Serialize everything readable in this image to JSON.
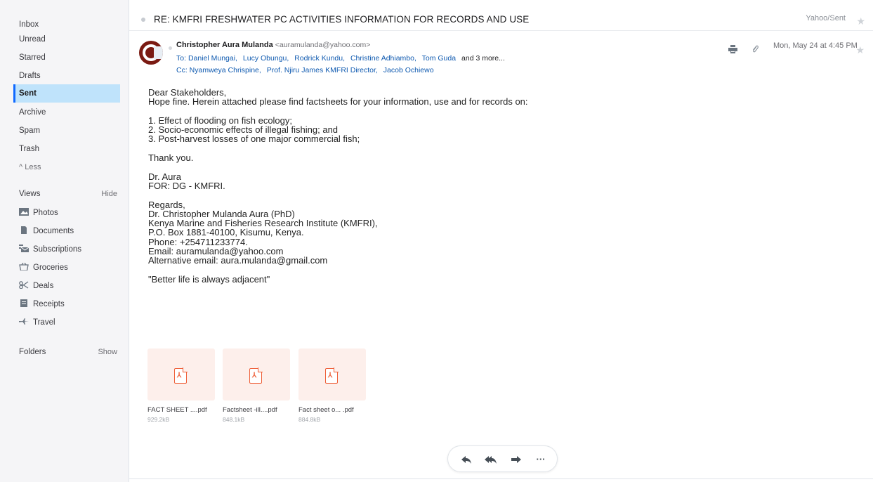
{
  "sidebar": {
    "items": [
      {
        "label": "Inbox"
      },
      {
        "label": "Unread"
      },
      {
        "label": "Starred"
      },
      {
        "label": "Drafts"
      },
      {
        "label": "Sent"
      },
      {
        "label": "Archive"
      },
      {
        "label": "Spam"
      },
      {
        "label": "Trash"
      },
      {
        "label": "^ Less"
      }
    ],
    "views_heading": "Views",
    "views_toggle": "Hide",
    "views": [
      {
        "label": "Photos",
        "icon": "photos-icon"
      },
      {
        "label": "Documents",
        "icon": "document-icon"
      },
      {
        "label": "Subscriptions",
        "icon": "subscriptions-icon"
      },
      {
        "label": "Groceries",
        "icon": "groceries-icon"
      },
      {
        "label": "Deals",
        "icon": "scissors-icon"
      },
      {
        "label": "Receipts",
        "icon": "receipt-icon"
      },
      {
        "label": "Travel",
        "icon": "plane-icon"
      }
    ],
    "folders_heading": "Folders",
    "folders_toggle": "Show"
  },
  "message": {
    "subject": "RE: KMFRI FRESHWATER PC ACTIVITIES INFORMATION FOR RECORDS AND USE",
    "folder": "Yahoo/Sent",
    "from_name": "Christopher Aura Mulanda",
    "from_email": "<auramulanda@yahoo.com>",
    "to_label": "To:",
    "to": [
      "Daniel Mungai,",
      "Lucy Obungu,",
      "Rodrick Kundu,",
      "Christine Adhiambo,",
      "Tom Guda"
    ],
    "to_more": "and 3 more...",
    "cc_label": "Cc:",
    "cc": [
      "Nyamweya Chrispine,",
      "Prof. Njiru James KMFRI Director,",
      "Jacob Ochiewo"
    ],
    "date": "Mon, May 24 at 4:45 PM",
    "body_lines": [
      "Dear Stakeholders,",
      "Hope fine. Herein attached please find factsheets for your information, use and for records on:",
      "",
      "1. Effect of flooding on fish ecology;",
      "2. Socio-economic effects of illegal fishing; and",
      "3. Post-harvest losses of one major commercial fish;",
      "",
      "Thank you.",
      "",
      "Dr. Aura",
      "FOR: DG - KMFRI.",
      "",
      "Regards,",
      "Dr. Christopher Mulanda Aura (PhD)",
      "Kenya Marine and Fisheries Research Institute (KMFRI),",
      "P.O. Box 1881-40100, Kisumu, Kenya.",
      "Phone: +254711233774.",
      "Email: auramulanda@yahoo.com",
      "Alternative email: aura.mulanda@gmail.com",
      "",
      "\"Better life is always adjacent\""
    ],
    "attachments": [
      {
        "name": "FACT SHEET ....pdf",
        "size": "929.2kB"
      },
      {
        "name": "Factsheet -ill....pdf",
        "size": "848.1kB"
      },
      {
        "name": "Fact sheet o... .pdf",
        "size": "884.8kB"
      }
    ]
  },
  "colors": {
    "accent": "#0f69ff",
    "selected_bg": "#bfe3fb",
    "pdf": "#ee5f38"
  }
}
